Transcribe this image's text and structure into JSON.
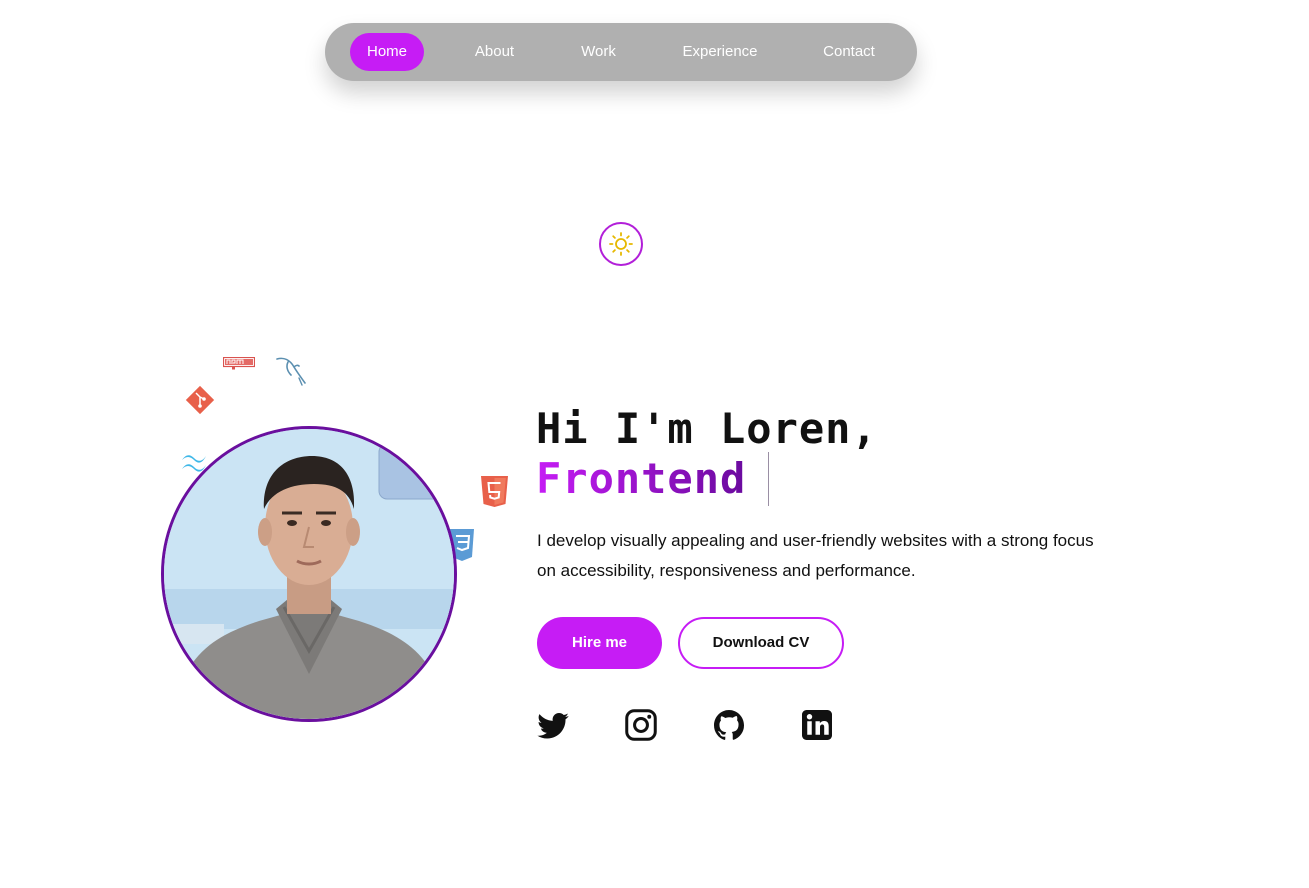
{
  "nav": {
    "items": [
      {
        "label": "Home",
        "active": true
      },
      {
        "label": "About",
        "active": false
      },
      {
        "label": "Work",
        "active": false
      },
      {
        "label": "Experience",
        "active": false
      },
      {
        "label": "Contact",
        "active": false
      }
    ]
  },
  "theme_toggle": {
    "icon": "sun-icon"
  },
  "tech_icons": [
    "npm-icon",
    "mysql-icon",
    "git-icon",
    "tailwind-icon",
    "html5-icon",
    "css3-icon"
  ],
  "hero": {
    "greeting": "Hi I'm Loren,",
    "role": "Frontend",
    "bio": "I develop visually appealing and user-friendly websites with a strong focus on accessibility, responsiveness and performance.",
    "hire_label": "Hire me",
    "cv_label": "Download CV"
  },
  "socials": [
    "twitter-icon",
    "instagram-icon",
    "github-icon",
    "linkedin-icon"
  ],
  "colors": {
    "accent": "#c61cf5",
    "accent_dark": "#6a0f9e",
    "nav_bg": "#b0b0b0"
  }
}
